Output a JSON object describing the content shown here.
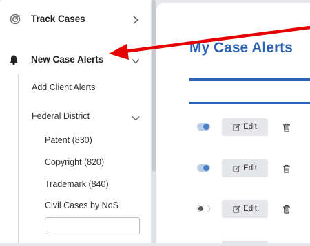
{
  "sidebar": {
    "track_cases": {
      "label": "Track Cases",
      "icon": "target-icon"
    },
    "new_case_alerts": {
      "label": "New Case Alerts",
      "icon": "bell-icon"
    },
    "add_client_alerts": "Add Client Alerts",
    "federal_district": "Federal District",
    "federal_items": [
      "Patent (830)",
      "Copyright (820)",
      "Trademark (840)"
    ],
    "civil_cases_label": "Civil Cases by NoS",
    "civil_cases_input_value": ""
  },
  "main": {
    "title": "My Case Alerts",
    "rows": [
      {
        "toggle": "on",
        "edit_label": "Edit"
      },
      {
        "toggle": "on",
        "edit_label": "Edit"
      },
      {
        "toggle": "off",
        "edit_label": "Edit"
      }
    ]
  },
  "colors": {
    "accent": "#2d63b3",
    "arrow": "#e60000"
  }
}
